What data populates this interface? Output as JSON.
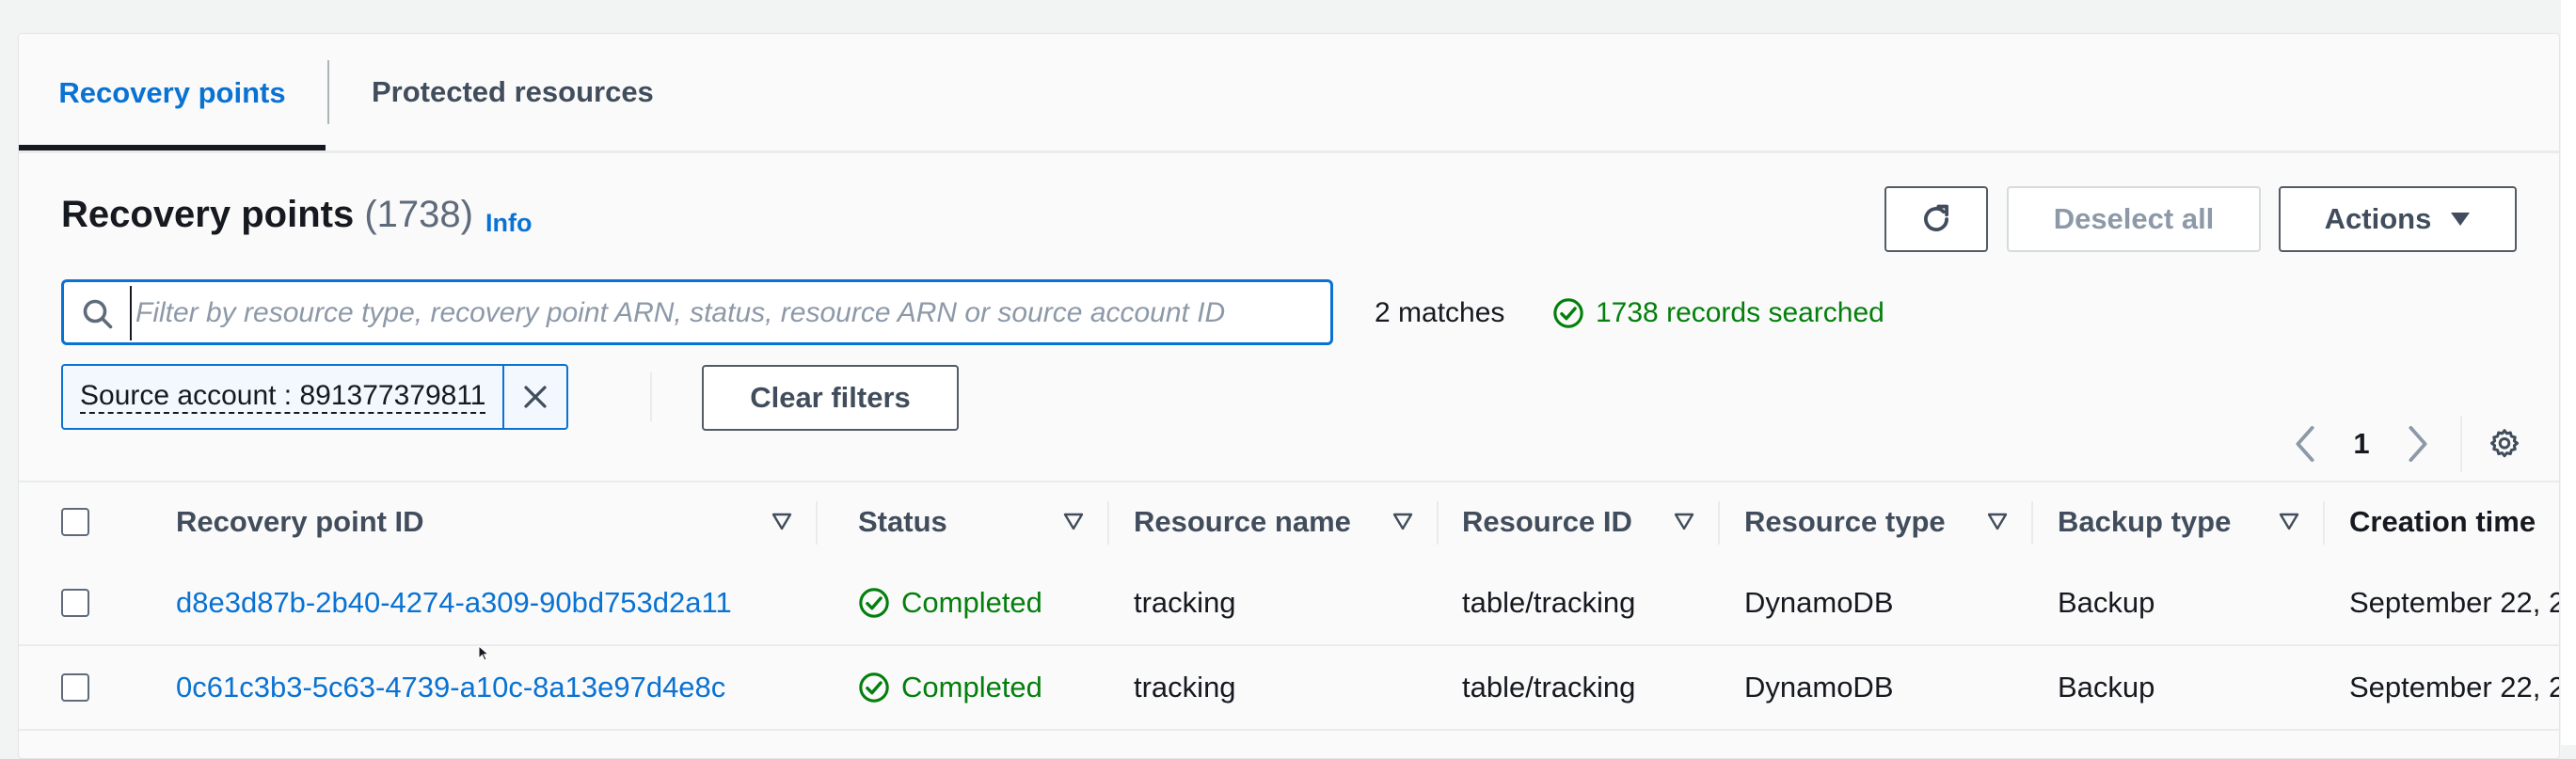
{
  "tabs": [
    {
      "label": "Recovery points",
      "active": true
    },
    {
      "label": "Protected resources",
      "active": false
    }
  ],
  "header": {
    "title": "Recovery points",
    "count": "(1738)",
    "info": "Info"
  },
  "toolbar": {
    "refresh_icon": "refresh-icon",
    "deselect_label": "Deselect all",
    "actions_label": "Actions"
  },
  "search": {
    "placeholder": "Filter by resource type, recovery point ARN, status, resource ARN or source account ID",
    "value": "",
    "matches": "2 matches",
    "records_searched": "1738 records searched"
  },
  "filter_token": {
    "label": "Source account : 891377379811"
  },
  "clear_filters_label": "Clear filters",
  "pagination": {
    "current_page": "1"
  },
  "table": {
    "columns": [
      "Recovery point ID",
      "Status",
      "Resource name",
      "Resource ID",
      "Resource type",
      "Backup type",
      "Creation time"
    ],
    "rows": [
      {
        "recovery_point_id": "d8e3d87b-2b40-4274-a309-90bd753d2a11",
        "status": "Completed",
        "resource_name": "tracking",
        "resource_id": "table/tracking",
        "resource_type": "DynamoDB",
        "backup_type": "Backup",
        "creation_time": "September 22, 2"
      },
      {
        "recovery_point_id": "0c61c3b3-5c63-4739-a10c-8a13e97d4e8c",
        "status": "Completed",
        "resource_name": "tracking",
        "resource_id": "table/tracking",
        "resource_type": "DynamoDB",
        "backup_type": "Backup",
        "creation_time": "September 22, 2"
      }
    ]
  },
  "colors": {
    "link": "#0972d3",
    "success": "#037f0c",
    "text": "#16191f",
    "muted": "#5f6b7a"
  }
}
